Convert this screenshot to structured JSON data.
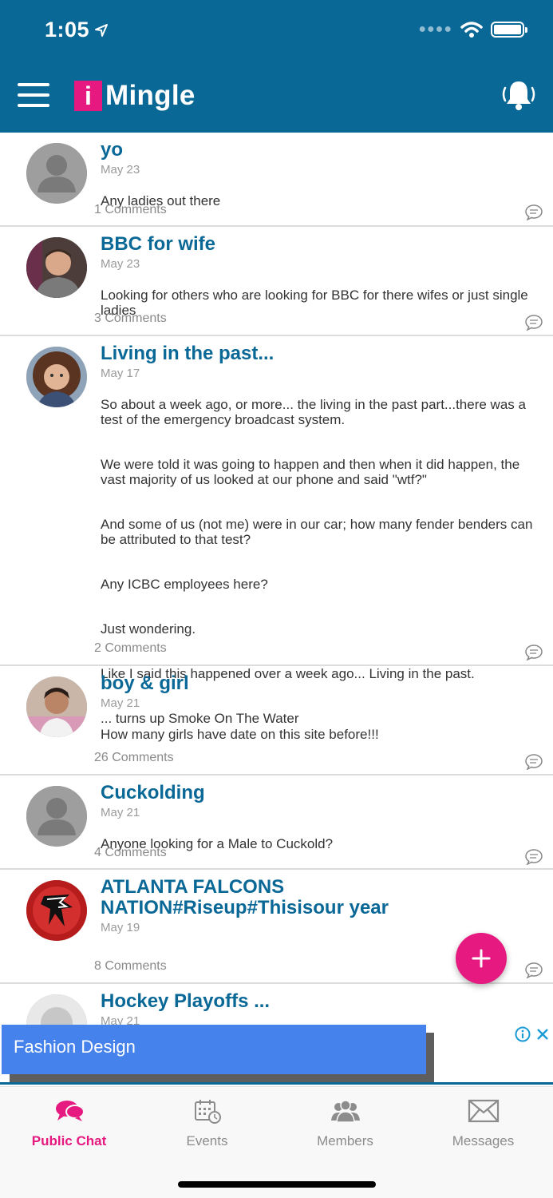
{
  "status_bar": {
    "time": "1:05"
  },
  "header": {
    "logo_letter": "i",
    "app_name": "Mingle",
    "brand_color": "#0a6897",
    "accent_color": "#e5197f"
  },
  "posts": [
    {
      "title": "yo",
      "date": "May 23",
      "paragraphs": [
        "Any ladies out there"
      ],
      "comments": "1 Comments",
      "avatar": "placeholder"
    },
    {
      "title": "BBC for wife",
      "date": "May 23",
      "paragraphs": [
        "Looking for others who are looking for BBC for there wifes or just single ladies"
      ],
      "comments": "3 Comments",
      "avatar": "photo"
    },
    {
      "title": "Living in the past...",
      "date": "May 17",
      "paragraphs": [
        "So about a week ago, or more... the living in the past part...there was a test of the emergency broadcast system.",
        "We were told it was going to happen and then when it did happen, the vast majority of us looked at our phone and said \"wtf?\"",
        "And some of us (not me) were in our car; how many fender benders can be attributed to that test?",
        "Any ICBC employees here?",
        "Just wondering.",
        "Like I said this happened over a week ago... Living in the past.",
        "... turns up Smoke On The Water"
      ],
      "comments": "2 Comments",
      "avatar": "photo"
    },
    {
      "title": "boy & girl",
      "date": "May 21",
      "paragraphs": [
        "How many girls have date on this site before!!!"
      ],
      "comments": "26 Comments",
      "avatar": "photo"
    },
    {
      "title": "Cuckolding",
      "date": "May 21",
      "paragraphs": [
        "Anyone looking for a Male to Cuckold?"
      ],
      "comments": "4 Comments",
      "avatar": "placeholder"
    },
    {
      "title": "ATLANTA FALCONS NATION#Riseup#Thisisour year",
      "date": "May 19",
      "paragraphs": [],
      "comments": "8 Comments",
      "avatar": "falcons-logo"
    },
    {
      "title": "Hockey Playoffs ...",
      "date": "May 21",
      "paragraphs": [],
      "comments": "",
      "avatar": "photo"
    }
  ],
  "ad": {
    "text": "Fashion Design"
  },
  "tabs": [
    {
      "label": "Public Chat",
      "icon": "chat-bubbles-icon",
      "active": true
    },
    {
      "label": "Events",
      "icon": "calendar-icon",
      "active": false
    },
    {
      "label": "Members",
      "icon": "people-icon",
      "active": false
    },
    {
      "label": "Messages",
      "icon": "envelope-icon",
      "active": false
    }
  ]
}
